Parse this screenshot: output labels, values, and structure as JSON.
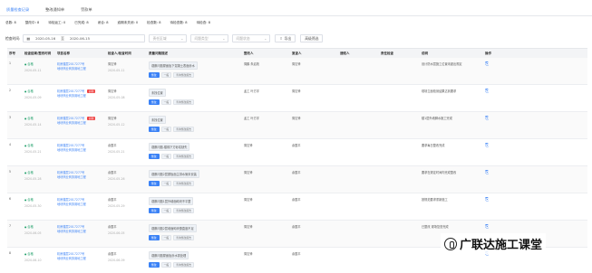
{
  "tabs": [
    "质量检查记录",
    "整改通知单",
    "罚款单"
  ],
  "stats": [
    "总数: 8",
    "整改中: 8",
    "待检返工: 0",
    "已完成: 8",
    "闭合: 8",
    "逾期未关闭: 0",
    "检查数: 8",
    "待检查数: 8",
    "待检查: 8"
  ],
  "toolbar": {
    "label": "检查时间:",
    "date_from": "2020-05-16",
    "date_sep": "至",
    "date_to": "2020-06-15",
    "sel1": "责任区域",
    "sel2": "问题类型",
    "sel3": "问题状态",
    "export": "导出",
    "advanced": "高级筛选"
  },
  "headers": [
    "序号",
    "检查结果/整改时间",
    "项目名称",
    "检查人/检查时间",
    "质量问题描述",
    "整改人",
    "复查人",
    "通知人",
    "责任检查",
    "说明",
    "操作"
  ],
  "rows": [
    {
      "n": "1",
      "r": "合格",
      "d": "2020-05-11",
      "p1": "机房楼层2017277号",
      "p2": "地块商业商务用地工程",
      "i": "周忘锋",
      "id": "2020-05-11",
      "q": "观察问题屋面板下混凝土表面渗水",
      "a1": "整改",
      "a2": "一般",
      "a3": "查询整改报告",
      "z": "周鹏 朱启苑",
      "f": "周忘锋",
      "t": "",
      "e": "",
      "s": "设计防水层施工位置未超出规定",
      "badge": ""
    },
    {
      "n": "2",
      "r": "合格",
      "d": "2020-05-09",
      "p1": "机房楼层2017277号",
      "p2": "地块商业商务用地工程",
      "i": "周忘锋",
      "id": "2020-05-08",
      "q": "未找位置",
      "a1": "整改",
      "a2": "一般",
      "a3": "查询整改报告",
      "z": "孟工 叶方宇",
      "f": "周忘锋",
      "t": "",
      "e": "",
      "s": "现场立面检测结果达到要求",
      "badge": "超期"
    },
    {
      "n": "3",
      "r": "合格",
      "d": "2020-05-14",
      "p1": "机房楼层2017277号",
      "p2": "地块商业商务用地工程",
      "i": "周忘锋",
      "id": "2020-05-12",
      "q": "未找位置",
      "a1": "整改",
      "a2": "一般",
      "a3": "查询整改报告",
      "z": "孟工 叶方宇",
      "f": "周忘锋",
      "t": "",
      "e": "",
      "s": "楼1层外墙脚水施工完成",
      "badge": "超期"
    },
    {
      "n": "4",
      "r": "合格",
      "d": "2020-05-21",
      "p1": "机房楼层2017277号",
      "p2": "地块商业商务用地工程",
      "i": "余国平",
      "id": "2020-05-21",
      "q": "观察问题-楼梯下方砂浆缺失",
      "a1": "整改",
      "a2": "一般",
      "a3": "查询整改报告",
      "z": "周忘锋",
      "f": "余国平",
      "t": "",
      "e": "",
      "s": "要求每日整改完成",
      "badge": ""
    },
    {
      "n": "5",
      "r": "合格",
      "d": "2020-05-28",
      "p1": "机房楼层2017277号",
      "p2": "地块商业商务用地工程",
      "i": "余国平",
      "id": "2020-05-26",
      "q": "观察问题2层屋板面主排水管未安装",
      "a1": "整改",
      "a2": "一般",
      "a3": "查询整改报告",
      "z": "周忘锋",
      "f": "余国平",
      "t": "",
      "e": "",
      "s": "要求在规定时间内完成整改",
      "badge": ""
    },
    {
      "n": "6",
      "r": "合格",
      "d": "2020-05-30",
      "p1": "机房楼层2017277号",
      "p2": "地块商业商务用地工程",
      "i": "余国平",
      "id": "2020-05-29",
      "q": "观察问题1层外墙面砌块不平整",
      "a1": "整改",
      "a2": "一般",
      "a3": "查询整改报告",
      "z": "周忘锋",
      "f": "余国平",
      "t": "",
      "e": "",
      "s": "按规范要求重新施工",
      "badge": ""
    },
    {
      "n": "7",
      "r": "合格",
      "d": "2020-06-05",
      "p1": "机房楼层2017277号",
      "p2": "地块商业商务用地工程",
      "i": "余国平",
      "id": "2020-06-05",
      "q": "观察问题2层墙面砌块垂直度不足",
      "a1": "整改",
      "a2": "一般",
      "a3": "查询整改报告",
      "z": "周忘锋",
      "f": "余国平",
      "t": "",
      "e": "",
      "s": "已整改 现场复查完成",
      "badge": ""
    },
    {
      "n": "8",
      "r": "合格",
      "d": "2020-06-10",
      "p1": "机房楼层2017277号",
      "p2": "地块商业商务用地工程",
      "i": "余国平",
      "id": "2020-06-09",
      "q": "观察问题屋面板渗水需处理",
      "a1": "整改",
      "a2": "一般",
      "a3": "查询整改报告",
      "z": "周忘锋",
      "f": "余国平",
      "t": "",
      "e": "",
      "s": "",
      "badge": ""
    }
  ],
  "watermark": "广联达施工课堂"
}
